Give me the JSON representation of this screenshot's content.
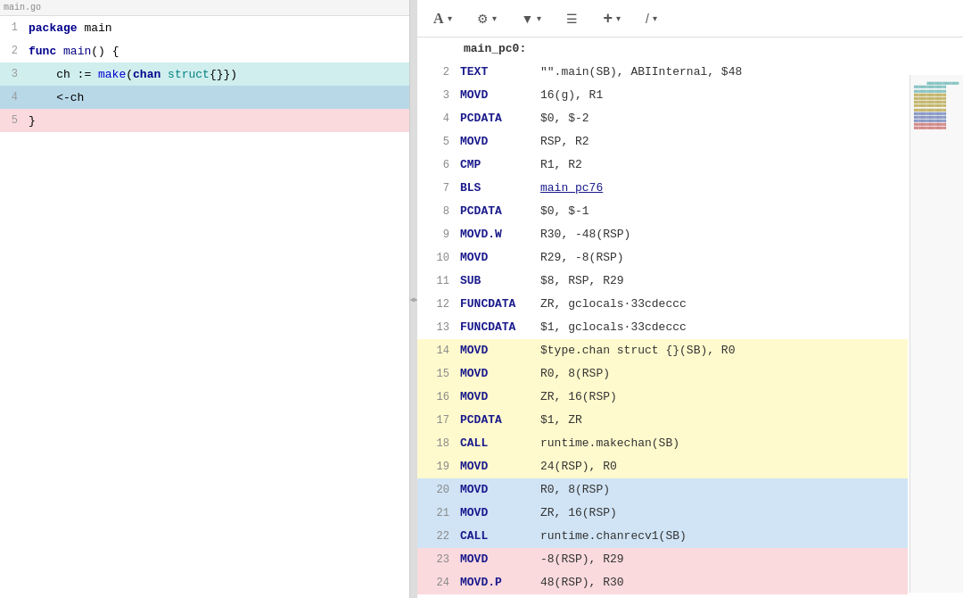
{
  "left": {
    "topbar": "main.go",
    "lines": [
      {
        "num": "1",
        "text": "package main",
        "bg": "",
        "tokens": [
          {
            "t": "kw",
            "v": "package"
          },
          {
            "t": "",
            "v": " main"
          }
        ]
      },
      {
        "num": "2",
        "text": "func main() {",
        "bg": "",
        "tokens": [
          {
            "t": "kw",
            "v": "func"
          },
          {
            "t": "",
            "v": " "
          },
          {
            "t": "fn",
            "v": "main"
          },
          {
            "t": "",
            "v": "() {"
          }
        ]
      },
      {
        "num": "3",
        "text": "\t\tch := make(chan struct{})",
        "bg": "bg-teal",
        "tokens": [
          {
            "t": "",
            "v": "    ch := "
          },
          {
            "t": "builtin",
            "v": "make"
          },
          {
            "t": "",
            "v": "("
          },
          {
            "t": "kw",
            "v": "chan"
          },
          {
            "t": "",
            "v": " "
          },
          {
            "t": "type",
            "v": "struct"
          },
          {
            "t": "",
            "v": "{}})"
          }
        ]
      },
      {
        "num": "4",
        "text": "\t\t<-ch",
        "bg": "bg-blue-active",
        "tokens": [
          {
            "t": "",
            "v": "    <-ch"
          }
        ]
      },
      {
        "num": "5",
        "text": "}",
        "bg": "bg-pink",
        "tokens": [
          {
            "t": "",
            "v": "}"
          }
        ]
      }
    ]
  },
  "right": {
    "toolbar": {
      "font_btn": "A",
      "settings_icon": "⚙",
      "filter_icon": "▼",
      "layout_icon": "☰",
      "add_icon": "+",
      "pen_icon": "✎"
    },
    "asm_rows": [
      {
        "num": "",
        "  op": "",
        "args": "main_pc0:",
        "bg": "",
        "is_label": true
      },
      {
        "num": "2",
        "op": "TEXT",
        "args": "\"\".main(SB), ABIInternal, $48",
        "bg": ""
      },
      {
        "num": "3",
        "op": "MOVD",
        "args": "16(g), R1",
        "bg": ""
      },
      {
        "num": "4",
        "op": "PCDATA",
        "args": "$0, $-2",
        "bg": ""
      },
      {
        "num": "5",
        "op": "MOVD",
        "args": "RSP, R2",
        "bg": ""
      },
      {
        "num": "6",
        "op": "CMP",
        "args": "R1, R2",
        "bg": ""
      },
      {
        "num": "7",
        "op": "BLS",
        "args": "main_pc76",
        "bg": "",
        "link": true
      },
      {
        "num": "8",
        "op": "PCDATA",
        "args": "$0, $-1",
        "bg": ""
      },
      {
        "num": "9",
        "op": "MOVD.W",
        "args": "R30, -48(RSP)",
        "bg": ""
      },
      {
        "num": "10",
        "op": "MOVD",
        "args": "R29, -8(RSP)",
        "bg": ""
      },
      {
        "num": "11",
        "op": "SUB",
        "args": "$8, RSP, R29",
        "bg": ""
      },
      {
        "num": "12",
        "op": "FUNCDATA",
        "args": "        ZR, gclocals·33cdeccc",
        "bg": ""
      },
      {
        "num": "13",
        "op": "FUNCDATA",
        "args": "        $1, gclocals·33cdeccc",
        "bg": ""
      },
      {
        "num": "14",
        "op": "MOVD",
        "args": "$type.chan struct {}(SB), R0",
        "bg": "bg-yellow"
      },
      {
        "num": "15",
        "op": "MOVD",
        "args": "R0, 8(RSP)",
        "bg": "bg-yellow"
      },
      {
        "num": "16",
        "op": "MOVD",
        "args": "ZR, 16(RSP)",
        "bg": "bg-yellow"
      },
      {
        "num": "17",
        "op": "PCDATA",
        "args": "$1, ZR",
        "bg": "bg-yellow"
      },
      {
        "num": "18",
        "op": "CALL",
        "args": "runtime.makechan(SB)",
        "bg": "bg-yellow"
      },
      {
        "num": "19",
        "op": "MOVD",
        "args": "24(RSP), R0",
        "bg": "bg-yellow"
      },
      {
        "num": "20",
        "op": "MOVD",
        "args": "R0, 8(RSP)",
        "bg": "bg-blue-asm"
      },
      {
        "num": "21",
        "op": "MOVD",
        "args": "ZR, 16(RSP)",
        "bg": "bg-blue-asm"
      },
      {
        "num": "22",
        "op": "CALL",
        "args": "runtime.chanrecv1(SB)",
        "bg": "bg-blue-asm"
      },
      {
        "num": "23",
        "op": "MOVD",
        "args": "-8(RSP), R29",
        "bg": "bg-pink-asm"
      },
      {
        "num": "24",
        "op": "MOVD.P",
        "args": "48(RSP), R30",
        "bg": "bg-pink-asm"
      }
    ]
  }
}
